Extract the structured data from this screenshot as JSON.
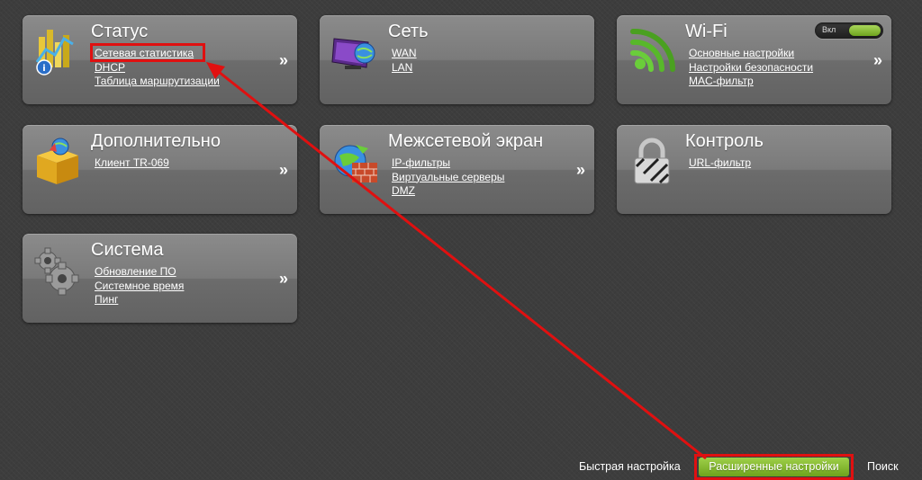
{
  "tiles": [
    {
      "title": "Статус",
      "icon": "status-chart-icon",
      "links": [
        "Сетевая статистика",
        "DHCP",
        "Таблица маршрутизации"
      ]
    },
    {
      "title": "Сеть",
      "icon": "network-monitor-icon",
      "links": [
        "WAN",
        "LAN"
      ]
    },
    {
      "title": "Wi-Fi",
      "icon": "wifi-icon",
      "toggle_label": "Вкл",
      "links": [
        "Основные настройки",
        "Настройки безопасности",
        "MAC-фильтр"
      ]
    },
    {
      "title": "Дополнительно",
      "icon": "package-box-icon",
      "links": [
        "Клиент TR-069"
      ]
    },
    {
      "title": "Межсетевой экран",
      "icon": "firewall-icon",
      "links": [
        "IP-фильтры",
        "Виртуальные серверы",
        "DMZ"
      ]
    },
    {
      "title": "Контроль",
      "icon": "padlock-icon",
      "links": [
        "URL-фильтр"
      ]
    },
    {
      "title": "Система",
      "icon": "gears-icon",
      "links": [
        "Обновление ПО",
        "Системное время",
        "Пинг"
      ]
    }
  ],
  "more_arrow": "»",
  "bottom_nav": {
    "quick_setup": "Быстрая настройка",
    "advanced_settings": "Расширенные настройки",
    "search": "Поиск"
  },
  "colors": {
    "background": "#3d3d3d",
    "tile": "#7a7a7a",
    "accent_green": "#8bc53f",
    "annotation_red": "#e01010"
  }
}
